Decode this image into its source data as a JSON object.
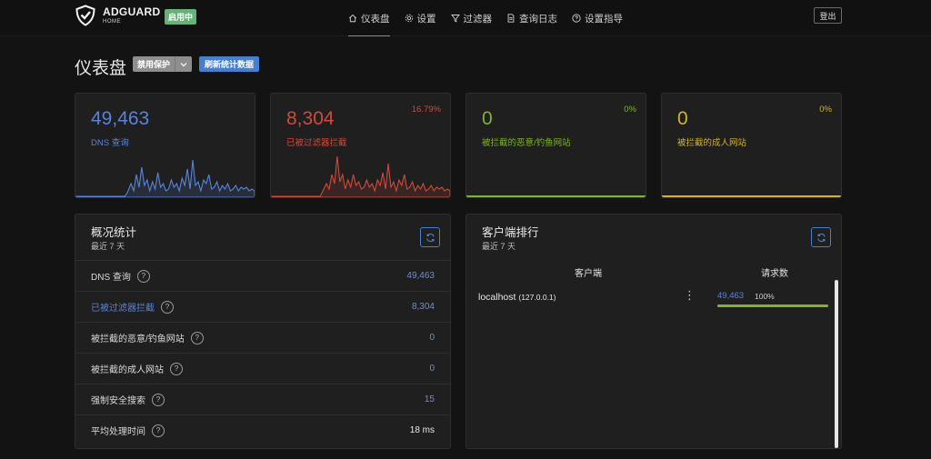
{
  "header": {
    "logo_name": "ADGUARD",
    "logo_sub": "HOME",
    "status_badge": "启用中",
    "nav": [
      {
        "label": "仪表盘",
        "icon": "home-icon",
        "active": true
      },
      {
        "label": "设置",
        "icon": "gear-icon",
        "active": false
      },
      {
        "label": "过滤器",
        "icon": "filter-icon",
        "active": false
      },
      {
        "label": "查询日志",
        "icon": "document-icon",
        "active": false
      },
      {
        "label": "设置指导",
        "icon": "help-icon",
        "active": false
      }
    ],
    "logout_label": "登出"
  },
  "page": {
    "title": "仪表盘",
    "disable_protection_label": "禁用保护",
    "refresh_stats_label": "刷新统计数据"
  },
  "stat_cards": [
    {
      "value": "49,463",
      "label": "DNS 查询",
      "percent": "",
      "color": "#5a83d8"
    },
    {
      "value": "8,304",
      "label": "已被过滤器拦截",
      "percent": "16.79%",
      "color": "#cf4a3b"
    },
    {
      "value": "0",
      "label": "被拦截的恶意/钓鱼网站",
      "percent": "0%",
      "color": "#7fb625"
    },
    {
      "value": "0",
      "label": "被拦截的成人网站",
      "percent": "0%",
      "color": "#d4b32a"
    }
  ],
  "general_stats": {
    "title": "概况统计",
    "subtitle": "最近 7 天",
    "rows": [
      {
        "label": "DNS 查询",
        "value": "49,463",
        "highlight": false
      },
      {
        "label": "已被过滤器拦截",
        "value": "8,304",
        "highlight": true
      },
      {
        "label": "被拦截的恶意/钓鱼网站",
        "value": "0",
        "highlight": false
      },
      {
        "label": "被拦截的成人网站",
        "value": "0",
        "highlight": false
      },
      {
        "label": "强制安全搜索",
        "value": "15",
        "highlight": false
      },
      {
        "label": "平均处理时间",
        "value": "18 ms",
        "highlight": false
      }
    ]
  },
  "top_clients": {
    "title": "客户端排行",
    "subtitle": "最近 7 天",
    "col_client": "客户端",
    "col_requests": "请求数",
    "rows": [
      {
        "name": "localhost",
        "ip": "(127.0.0.1)",
        "count": "49,463",
        "percent": "100%",
        "fraction": 1.0
      }
    ]
  }
}
